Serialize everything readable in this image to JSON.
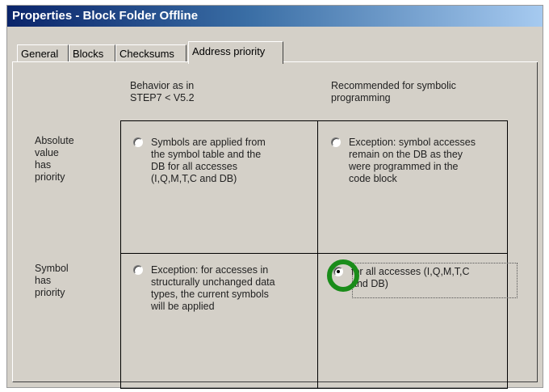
{
  "window": {
    "title": "Properties - Block Folder Offline"
  },
  "tabs": [
    {
      "label": "General",
      "active": false
    },
    {
      "label": "Blocks",
      "active": false
    },
    {
      "label": "Checksums",
      "active": false
    },
    {
      "label": "Address priority",
      "active": true
    }
  ],
  "columns": {
    "left": "Behavior as in\nSTEP7 < V5.2",
    "right": "Recommended for symbolic\nprogramming"
  },
  "rows": {
    "absolute": "Absolute\nvalue\nhas\npriority",
    "symbol": "Symbol\nhas\npriority"
  },
  "options": {
    "abs_left": {
      "label": "Symbols are applied from\nthe symbol table and the\nDB for all accesses\n(I,Q,M,T,C and DB)",
      "checked": false
    },
    "abs_right": {
      "label": "Exception: symbol accesses\nremain on the DB as they\nwere programmed in the\ncode block",
      "checked": false
    },
    "sym_left": {
      "label": "Exception: for accesses in\nstructurally unchanged data\ntypes, the current symbols\nwill be applied",
      "checked": false
    },
    "sym_right": {
      "label": "for all accesses (I,Q,M,T,C\nand DB)",
      "checked": true
    }
  },
  "colors": {
    "highlight_ring": "#1a8c1a",
    "dialog_bg": "#d4d0c8",
    "title_start": "#0a246a"
  }
}
